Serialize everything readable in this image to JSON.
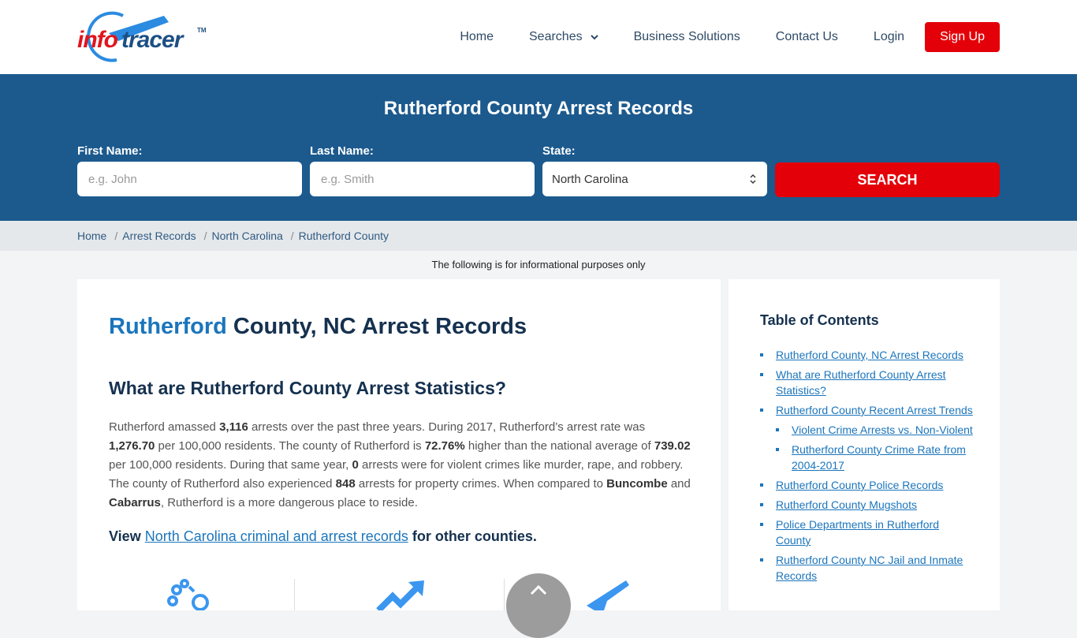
{
  "header": {
    "logo": {
      "part1": "info",
      "part2": "tracer",
      "tm": "TM"
    },
    "nav": [
      {
        "label": "Home"
      },
      {
        "label": "Searches",
        "has_dropdown": true
      },
      {
        "label": "Business Solutions"
      },
      {
        "label": "Contact Us"
      },
      {
        "label": "Login"
      }
    ],
    "signup_label": "Sign Up"
  },
  "hero": {
    "title": "Rutherford County Arrest Records",
    "first_name": {
      "label": "First Name:",
      "placeholder": "e.g. John"
    },
    "last_name": {
      "label": "Last Name:",
      "placeholder": "e.g. Smith"
    },
    "state": {
      "label": "State:",
      "value": "North Carolina"
    },
    "search_label": "SEARCH"
  },
  "breadcrumb": [
    "Home",
    "Arrest Records",
    "North Carolina",
    "Rutherford County"
  ],
  "notice": "The following is for informational purposes only",
  "main": {
    "title_accent": "Rutherford",
    "title_rest": " County, NC Arrest Records",
    "subtitle": "What are Rutherford County Arrest Statistics?",
    "para": {
      "t1": "Rutherford amassed ",
      "b1": "3,116",
      "t2": " arrests over the past three years. During 2017, Rutherford’s arrest rate was ",
      "b2": "1,276.70",
      "t3": " per 100,000 residents. The county of Rutherford is ",
      "b3": "72.76%",
      "t4": " higher than the national average of ",
      "b4": "739.02",
      "t5": " per 100,000 residents. During that same year, ",
      "b5": "0",
      "t6": " arrests were for violent crimes like murder, rape, and robbery. The county of Rutherford also experienced ",
      "b6": "848",
      "t7": " arrests for property crimes. When compared to ",
      "b7": "Buncombe",
      "t8": " and ",
      "b8": "Cabarrus",
      "t9": ", Rutherford is a more dangerous place to reside."
    },
    "view": {
      "pre": "View ",
      "link": "North Carolina criminal and arrest records",
      "post": " for other counties."
    },
    "stat_icons": [
      "handcuffs-icon",
      "trend-up-icon",
      "gun-icon"
    ]
  },
  "toc": {
    "title": "Table of Contents",
    "items": [
      {
        "label": "Rutherford County, NC Arrest Records",
        "level": 1
      },
      {
        "label": "What are Rutherford County Arrest Statistics?",
        "level": 1
      },
      {
        "label": "Rutherford County Recent Arrest Trends",
        "level": 1
      },
      {
        "label": "Violent Crime Arrests vs. Non-Violent",
        "level": 2
      },
      {
        "label": "Rutherford County Crime Rate from 2004-2017",
        "level": 2
      },
      {
        "label": "Rutherford County Police Records",
        "level": 1
      },
      {
        "label": "Rutherford County Mugshots",
        "level": 1
      },
      {
        "label": "Police Departments in Rutherford County",
        "level": 1
      },
      {
        "label": "Rutherford County NC Jail and Inmate Records",
        "level": 1
      }
    ]
  },
  "colors": {
    "brand_blue": "#1c5a8e",
    "accent_red": "#e30009",
    "link_blue": "#1b75bc"
  }
}
